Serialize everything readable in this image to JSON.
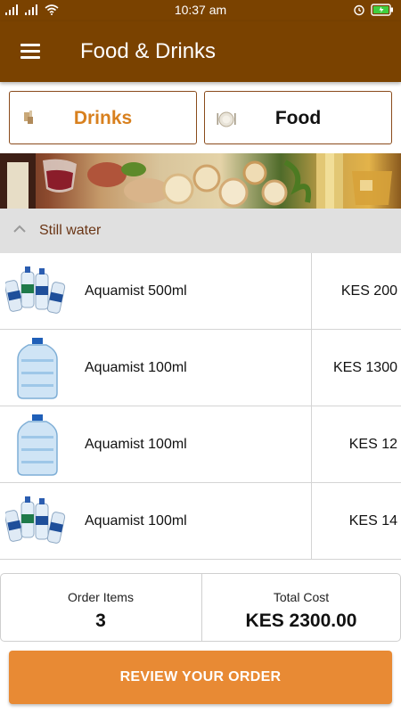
{
  "status_bar": {
    "time": "10:37 am"
  },
  "app_bar": {
    "title": "Food & Drinks"
  },
  "tabs": [
    {
      "label": "Drinks",
      "icon": "drink-icon",
      "active": true
    },
    {
      "label": "Food",
      "icon": "plate-icon",
      "active": false
    }
  ],
  "category": {
    "label": "Still water",
    "expanded": true
  },
  "items": [
    {
      "name": "Aquamist 500ml",
      "price": "KES 200",
      "image": "water-bottles-group"
    },
    {
      "name": "Aquamist 100ml",
      "price": "KES 1300",
      "image": "water-jug"
    },
    {
      "name": "Aquamist 100ml",
      "price": "KES 12",
      "image": "water-jug"
    },
    {
      "name": "Aquamist 100ml",
      "price": "KES 14",
      "image": "water-bottles-group"
    }
  ],
  "summary": {
    "order_items_label": "Order Items",
    "order_items_value": "3",
    "total_cost_label": "Total Cost",
    "total_cost_value": "KES 2300.00"
  },
  "review_button": {
    "label": "REVIEW YOUR ORDER"
  },
  "colors": {
    "brand": "#7a4200",
    "accent": "#e88a34",
    "drinks_tab_text": "#d8801e",
    "category_text": "#6a3515"
  }
}
